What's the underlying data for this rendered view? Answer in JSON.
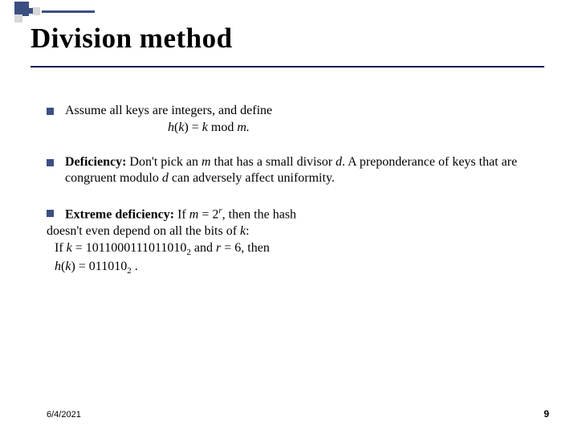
{
  "title": "Division method",
  "bullets": {
    "b1": {
      "line1": "Assume all keys are integers, and define",
      "formula_h": "h",
      "formula_k1": "(k)",
      "formula_eq": " = ",
      "formula_k2": "k",
      "formula_mod": " mod ",
      "formula_m": "m.",
      "formula_lparen": "(",
      "formula_rparen": ")"
    },
    "b2": {
      "label": "Deficiency:",
      "text_a": " Don't pick an ",
      "m1": "m",
      "text_b": " that has a small divisor ",
      "d1": "d",
      "text_c": ". A preponderance of keys that are congruent modulo ",
      "d2": "d",
      "text_d": " can adversely affect uniformity."
    },
    "b3": {
      "label": "Extreme deficiency:",
      "text_a": " If ",
      "m": "m",
      "text_b": " = 2",
      "r_sup": "r",
      "text_c": ", then the hash",
      "line2": "doesn't even depend on all the bits of ",
      "k": "k",
      "colon": ":",
      "if": " If ",
      "k2": "k",
      "eq1": " = 1011000111011010",
      "sub1": "2",
      "and": " and ",
      "r": "r",
      "eq2": " = 6, then",
      "hk": "h",
      "lparen": "(",
      "k3": "k",
      "rparen": ")",
      "eq3": " = 011010",
      "sub2": "2",
      "dot": " ."
    }
  },
  "footer": {
    "date": "6/4/2021",
    "page": "9"
  }
}
